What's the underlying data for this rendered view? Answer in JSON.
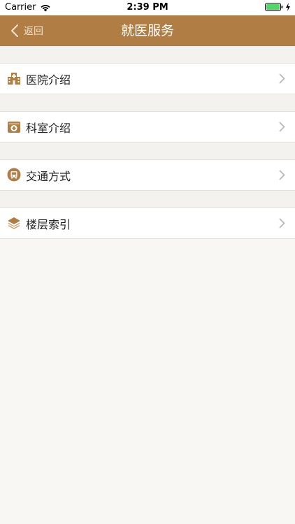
{
  "status": {
    "carrier": "Carrier",
    "time": "2:39 PM",
    "battery_color": "#4cd964"
  },
  "nav": {
    "back_label": "返回",
    "title": "就医服务",
    "background": "#b07e45"
  },
  "menu": [
    {
      "label": "医院介绍",
      "icon": "hospital-icon"
    },
    {
      "label": "科室介绍",
      "icon": "medical-kit-icon"
    },
    {
      "label": "交通方式",
      "icon": "bus-icon"
    },
    {
      "label": "楼层索引",
      "icon": "layers-icon"
    }
  ],
  "accent": "#b07e45"
}
